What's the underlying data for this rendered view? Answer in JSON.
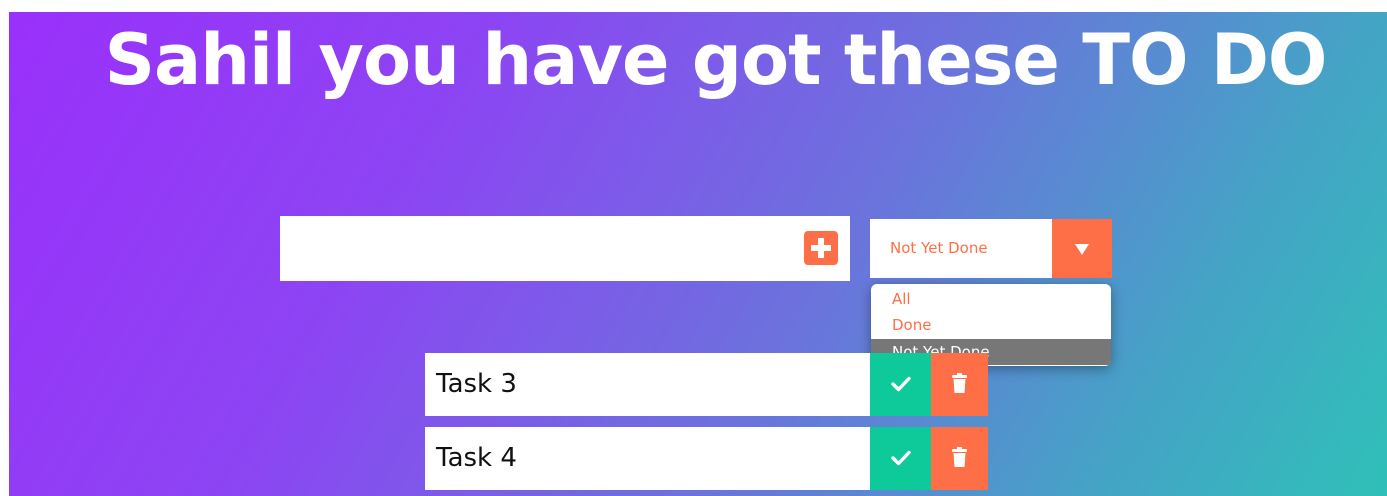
{
  "header": {
    "title": "Sahil you have got these TO DO"
  },
  "form": {
    "input_value": "",
    "add_icon": "plus-square-icon",
    "filter": {
      "selected": "Not Yet Done",
      "arrow_icon": "caret-down-icon",
      "options": [
        "All",
        "Done",
        "Not Yet Done"
      ]
    }
  },
  "todos": [
    {
      "text": "Task 3",
      "complete_icon": "check-icon",
      "delete_icon": "trash-icon"
    },
    {
      "text": "Task 4",
      "complete_icon": "check-icon",
      "delete_icon": "trash-icon"
    }
  ],
  "colors": {
    "accent": "#ff6f47",
    "complete": "#0ec99a",
    "selected_option_bg": "#777777",
    "gradient_start": "#9a30fb",
    "gradient_end": "#2fc0b8"
  }
}
